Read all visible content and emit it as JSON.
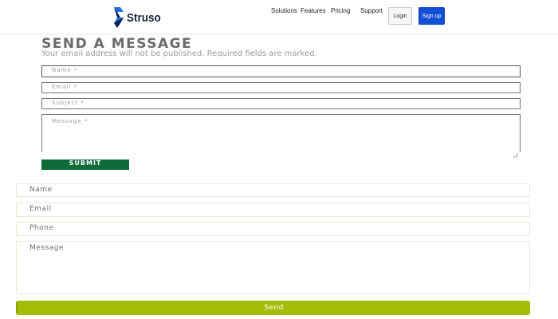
{
  "header": {
    "brand_name": "Struso",
    "brand_logo_icon": "struso-logo-icon",
    "nav": [
      "Solutions",
      "Features",
      "Pricing",
      "Support"
    ],
    "login_label": "Login",
    "signup_label": "Sign up",
    "colors": {
      "logo_primary": "#1f6fe6",
      "logo_secondary": "#0b1f4b",
      "signup_bg": "#1350d8"
    }
  },
  "message_form": {
    "title": "SEND A MESSAGE",
    "subtitle": "Your email address will not be published. Required fields are marked.",
    "fields": {
      "name_placeholder": "Name *",
      "email_placeholder": "Email *",
      "subject_placeholder": "Subject *",
      "message_placeholder": "Message *"
    },
    "submit_label": "SUBMIT",
    "colors": {
      "submit_bg": "#0f6b3a"
    }
  },
  "contact_form": {
    "fields": {
      "name_placeholder": "Name",
      "email_placeholder": "Email",
      "phone_placeholder": "Phone",
      "message_placeholder": "Message"
    },
    "send_label": "Send",
    "colors": {
      "send_bg": "#a3bd06"
    }
  }
}
